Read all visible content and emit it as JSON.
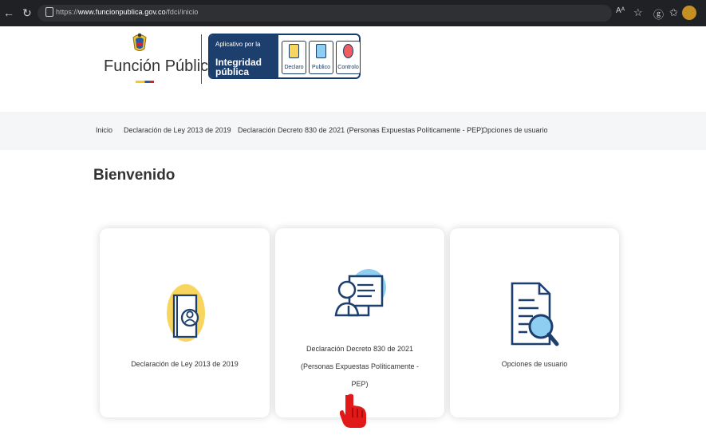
{
  "browser": {
    "url": "https://www.funcionpublica.gov.co/fdci/inicio",
    "url_prefix": "https://",
    "url_domain": "www.funcionpublica.gov.co",
    "url_path": "/fdci/inicio"
  },
  "header": {
    "brand": "Función Pública",
    "app_small": "Aplicativo por la",
    "app_big": "Integridad pública",
    "tiles": [
      {
        "label": "Declaro"
      },
      {
        "label": "Publico"
      },
      {
        "label": "Controlo"
      }
    ]
  },
  "nav": {
    "items": [
      {
        "label": "Inicio"
      },
      {
        "label": "Declaración de Ley 2013 de 2019"
      },
      {
        "label": "Declaración Decreto 830 de 2021 (Personas Expuestas Políticamente - PEP)"
      },
      {
        "label": "Opciones de usuario"
      }
    ]
  },
  "main": {
    "title": "Bienvenido",
    "cards": [
      {
        "label": "Declaración de Ley 2013 de 2019",
        "icon": "book-user-icon"
      },
      {
        "label_line_1": "Declaración Decreto 830 de 2021",
        "label_line_2": "(Personas Expuestas Políticamente -",
        "label_line_3": "PEP)",
        "icon": "computer-person-icon"
      },
      {
        "label": "Opciones de usuario",
        "icon": "document-search-icon"
      }
    ]
  },
  "colors": {
    "brand_blue": "#1d3f6e",
    "accent_yellow": "#f7d55f",
    "accent_blue": "#8ecff1",
    "pointer_red": "#e11919"
  }
}
